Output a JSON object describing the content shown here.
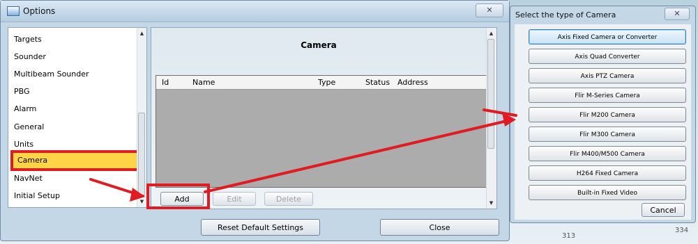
{
  "options_window": {
    "title": "Options",
    "nav_items": [
      "Targets",
      "Sounder",
      "Multibeam Sounder",
      "PBG",
      "Alarm",
      "General",
      "Units",
      "Camera",
      "NavNet",
      "Initial Setup"
    ],
    "selected_nav": "Camera",
    "panel_title": "Camera",
    "grid_columns": [
      "Id",
      "Name",
      "Type",
      "Status",
      "Address"
    ],
    "buttons": {
      "add": "Add",
      "edit": "Edit",
      "delete": "Delete"
    },
    "reset_label": "Reset Default Settings",
    "close_label": "Close"
  },
  "camera_dialog": {
    "title": "Select the type of Camera",
    "types": [
      "Axis Fixed Camera or Converter",
      "Axis Quad Converter",
      "Axis PTZ Camera",
      "Flir M-Series Camera",
      "Flir M200 Camera",
      "Flir M300 Camera",
      "Flir M400/M500 Camera",
      "H264 Fixed Camera",
      "Built-in Fixed Video"
    ],
    "cancel_label": "Cancel"
  },
  "map": {
    "numbers": [
      "313",
      "334"
    ]
  },
  "colors": {
    "highlight": "#ffd447",
    "annotation_red": "#e11b22"
  }
}
